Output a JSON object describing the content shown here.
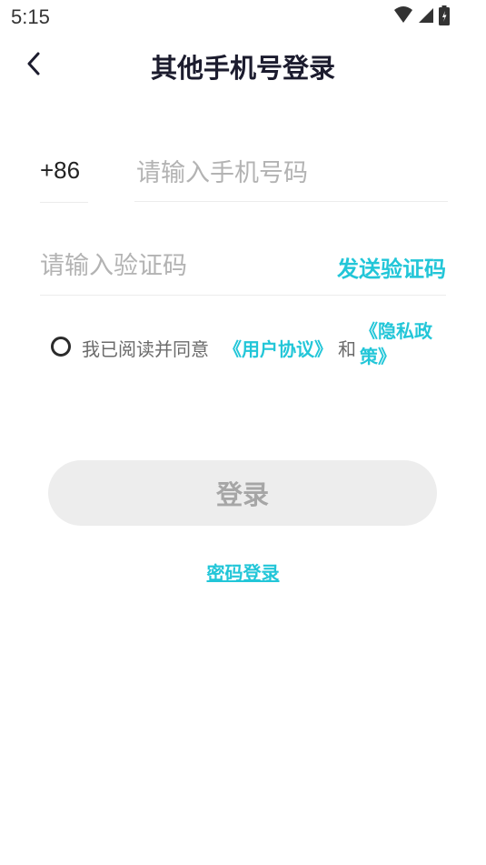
{
  "status_bar": {
    "time": "5:15",
    "icons": [
      "wifi-icon",
      "signal-icon",
      "battery-icon"
    ]
  },
  "nav": {
    "title": "其他手机号登录",
    "back_icon": "chevron-left-icon"
  },
  "form": {
    "country_code": "+86",
    "phone_placeholder": "请输入手机号码",
    "phone_value": "",
    "code_placeholder": "请输入验证码",
    "code_value": "",
    "send_code_label": "发送验证码"
  },
  "agreement": {
    "checked": false,
    "prefix": "我已阅读并同意",
    "user_agreement_link": "《用户协议》",
    "and_text": "和",
    "privacy_policy_link": "《隐私政策》"
  },
  "actions": {
    "login_label": "登录",
    "password_login_label": "密码登录"
  },
  "colors": {
    "accent": "#22c6d8",
    "title": "#1c1c2e",
    "placeholder": "#b3b3b3",
    "button_bg_disabled": "#ededed",
    "button_text_disabled": "#a6a6a6"
  }
}
